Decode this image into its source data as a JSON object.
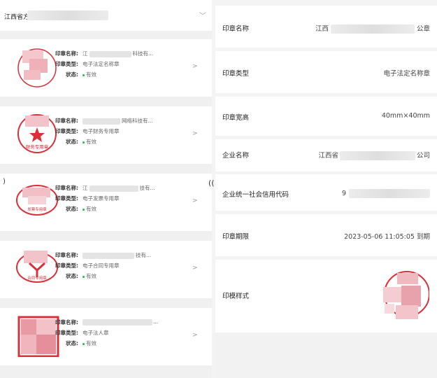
{
  "region": {
    "label": "江西省方"
  },
  "seal_labels": {
    "name": "印章名称:",
    "type": "印章类型:",
    "status": "状态:"
  },
  "seals": [
    {
      "name": "江",
      "name_tail": "科技有...",
      "type": "电子法定名称章",
      "status": "有效"
    },
    {
      "name": "",
      "name_tail": "网络科技有...",
      "type": "电子财务专用章",
      "status": "有效",
      "seal_text": "财务专用章"
    },
    {
      "name": "江",
      "name_tail": "技有...",
      "type": "电子发票专用章",
      "status": "有效",
      "seal_text": "发票专用章"
    },
    {
      "name": "",
      "name_tail": "技有...",
      "type": "电子合同专用章",
      "status": "有效",
      "seal_text": "合同专用章"
    },
    {
      "name": "",
      "name_tail": "...",
      "type": "电子法人章",
      "status": "有效"
    }
  ],
  "detail": {
    "seal_name_label": "印章名称",
    "seal_name_prefix": "江西",
    "seal_name_suffix": "公章",
    "seal_type_label": "印章类型",
    "seal_type_value": "电子法定名称章",
    "seal_size_label": "印章宽高",
    "seal_size_value": "40mm×40mm",
    "company_label": "企业名称",
    "company_prefix": "江西省",
    "company_suffix": "公司",
    "credit_code_label": "企业统一社会信用代码",
    "credit_code_prefix": "9",
    "expiry_label": "印章期限",
    "expiry_value": "2023-05-06 11:05:05 到期",
    "style_label": "印模样式"
  },
  "colors": {
    "seal_red": "#d9303a",
    "status_green": "#2db55d",
    "gap_gray": "#f0f0f0"
  },
  "icons": [
    "chevron-down-icon",
    "chevron-right-icon",
    "status-dot-icon",
    "star-icon"
  ]
}
